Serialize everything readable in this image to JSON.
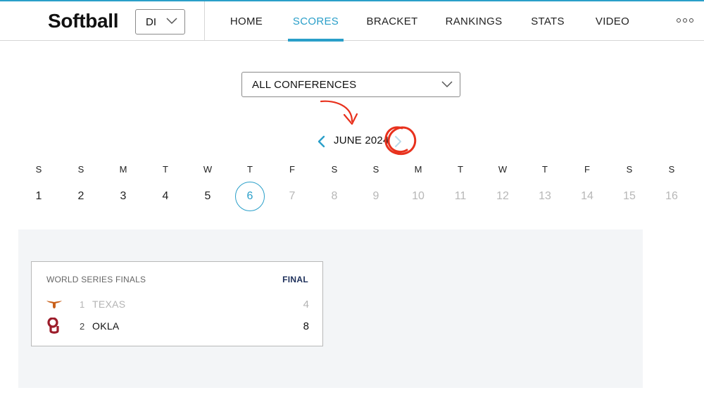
{
  "header": {
    "brand": "Softball",
    "division_value": "DI",
    "nav": [
      {
        "label": "HOME"
      },
      {
        "label": "SCORES"
      },
      {
        "label": "BRACKET"
      },
      {
        "label": "RANKINGS"
      },
      {
        "label": "STATS"
      },
      {
        "label": "VIDEO"
      }
    ],
    "active_nav": "SCORES"
  },
  "filters": {
    "conference_value": "ALL CONFERENCES"
  },
  "calendar": {
    "month_label": "JUNE 2024",
    "weekdays": [
      "S",
      "S",
      "M",
      "T",
      "W",
      "T",
      "F",
      "S",
      "S",
      "M",
      "T",
      "W",
      "T",
      "F",
      "S",
      "S"
    ],
    "days": [
      "1",
      "2",
      "3",
      "4",
      "5",
      "6",
      "7",
      "8",
      "9",
      "10",
      "11",
      "12",
      "13",
      "14",
      "15",
      "16"
    ],
    "selected_day": "6"
  },
  "game": {
    "round": "WORLD SERIES FINALS",
    "status": "FINAL",
    "teams": [
      {
        "seed": "1",
        "name": "TEXAS",
        "score": "4",
        "logo": "longhorn-logo"
      },
      {
        "seed": "2",
        "name": "OKLA",
        "score": "8",
        "logo": "oklahoma-ou-logo"
      }
    ]
  },
  "colors": {
    "accent": "#2a9fc9",
    "annotation": "#e8311d",
    "status": "#1d2f5a",
    "texas": "#c9601a",
    "oklahoma": "#9c1c2a",
    "panel_bg": "#f3f5f7"
  }
}
